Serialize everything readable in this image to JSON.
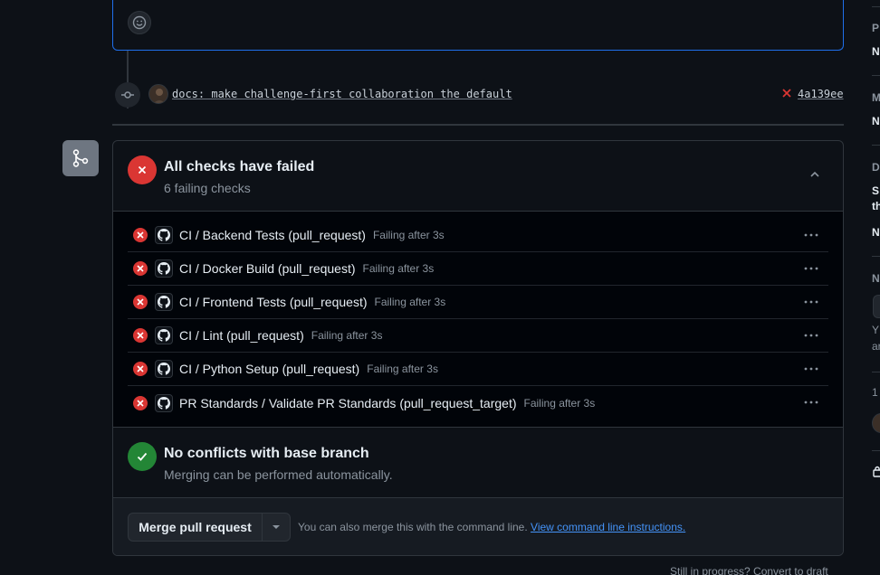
{
  "commit": {
    "message": "docs: make challenge-first collaboration the default",
    "sha": "4a139ee"
  },
  "checks": {
    "title": "All checks have failed",
    "subtitle": "6 failing checks",
    "items": [
      {
        "name": "CI / Backend Tests (pull_request)",
        "status": "Failing after 3s"
      },
      {
        "name": "CI / Docker Build (pull_request)",
        "status": "Failing after 3s"
      },
      {
        "name": "CI / Frontend Tests (pull_request)",
        "status": "Failing after 3s"
      },
      {
        "name": "CI / Lint (pull_request)",
        "status": "Failing after 3s"
      },
      {
        "name": "CI / Python Setup (pull_request)",
        "status": "Failing after 3s"
      },
      {
        "name": "PR Standards / Validate PR Standards (pull_request_target)",
        "status": "Failing after 3s"
      }
    ]
  },
  "conflicts": {
    "title": "No conflicts with base branch",
    "subtitle": "Merging can be performed automatically."
  },
  "merge": {
    "button_label": "Merge pull request",
    "hint": "You can also merge this with the command line.",
    "link": "View command line instructions."
  },
  "draft": {
    "text": "Still in progress? Convert to draft"
  },
  "sidebar": {
    "letters": [
      "P",
      "N",
      "M",
      "N",
      "D",
      "S",
      "th",
      "N",
      "N",
      "Y",
      "ar",
      "1"
    ]
  },
  "colors": {
    "failure": "#da3633",
    "success": "#238636",
    "link": "#4493f8",
    "accent_border": "#1f6feb"
  },
  "icons": {
    "emoji": "smiley-icon",
    "commit": "git-commit-icon",
    "merge": "git-merge-icon",
    "fail": "x-circle-icon",
    "success": "check-circle-icon",
    "collapse": "chevron-up-icon",
    "row_menu": "kebab-horizontal-icon",
    "github": "github-mark-icon",
    "lock": "lock-icon"
  }
}
